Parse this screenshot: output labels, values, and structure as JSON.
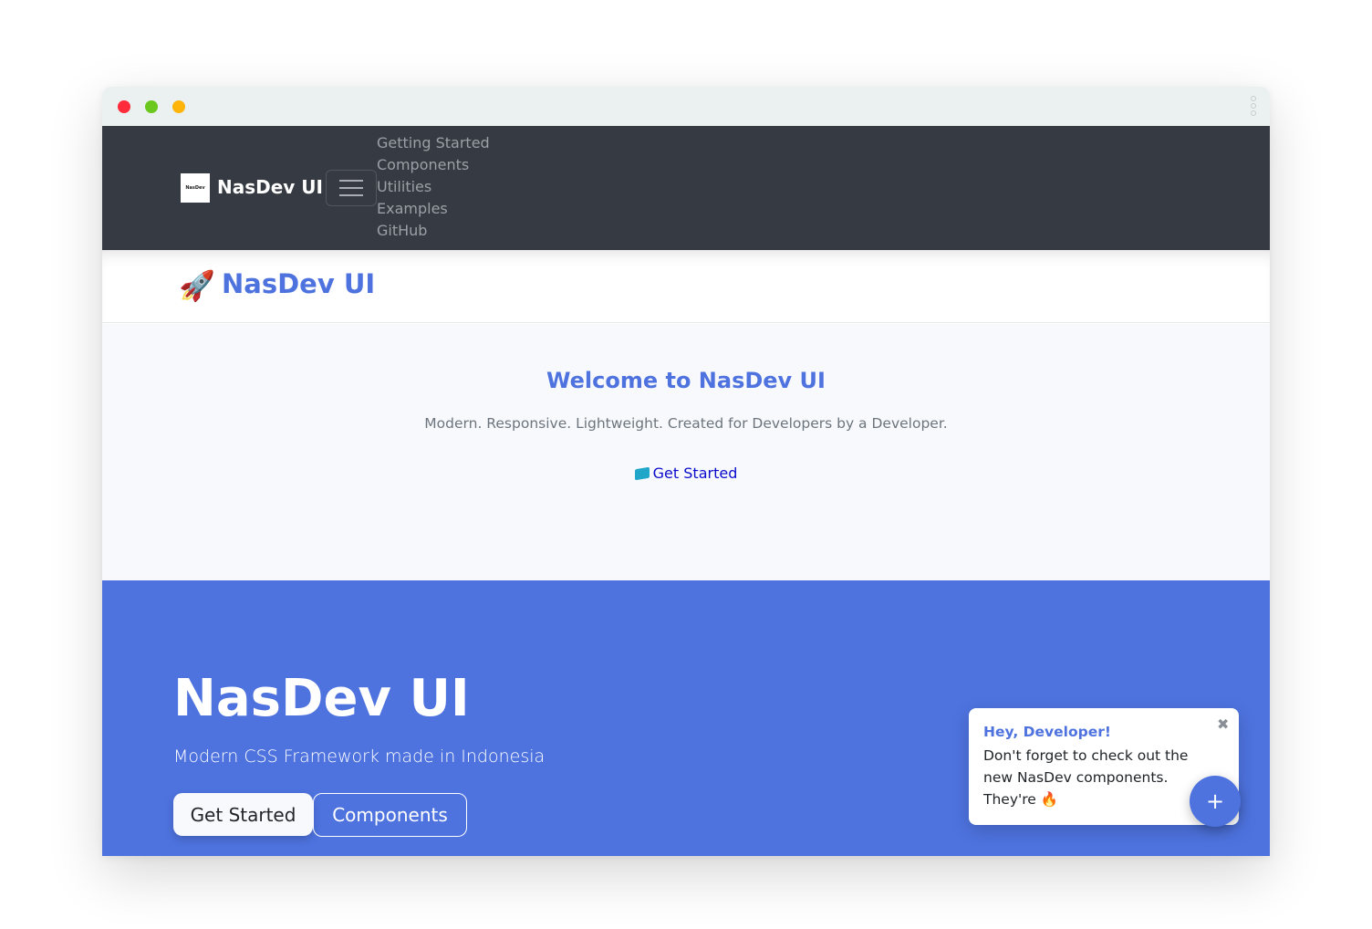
{
  "window": {
    "controls": [
      "close",
      "minimize",
      "maximize"
    ],
    "menu_icon": "kebab-vertical-icon"
  },
  "navbar": {
    "logo_text": "NasDev",
    "brand": "NasDev UI",
    "toggle_icon": "hamburger-icon",
    "links": [
      "Getting Started",
      "Components",
      "Utilities",
      "Examples",
      "GitHub"
    ]
  },
  "subheader": {
    "icon": "🚀",
    "title": "NasDev UI"
  },
  "welcome": {
    "heading": "Welcome to NasDev UI",
    "lead": "Modern. Responsive. Lightweight. Created for Developers by a Developer.",
    "cta_icon": "book-icon",
    "cta_label": "Get Started"
  },
  "hero": {
    "title": "NasDev UI",
    "subtitle": "Modern CSS Framework made in Indonesia",
    "primary_button": "Get Started",
    "secondary_button": "Components"
  },
  "toast": {
    "title": "Hey, Developer!",
    "body": "Don't forget to check out the new NasDev components. They're 🔥",
    "close": "✖"
  },
  "fab": {
    "label": "+"
  },
  "colors": {
    "accent": "#4e73df",
    "navbar": "#363a42",
    "link": "#0b0bcc"
  }
}
